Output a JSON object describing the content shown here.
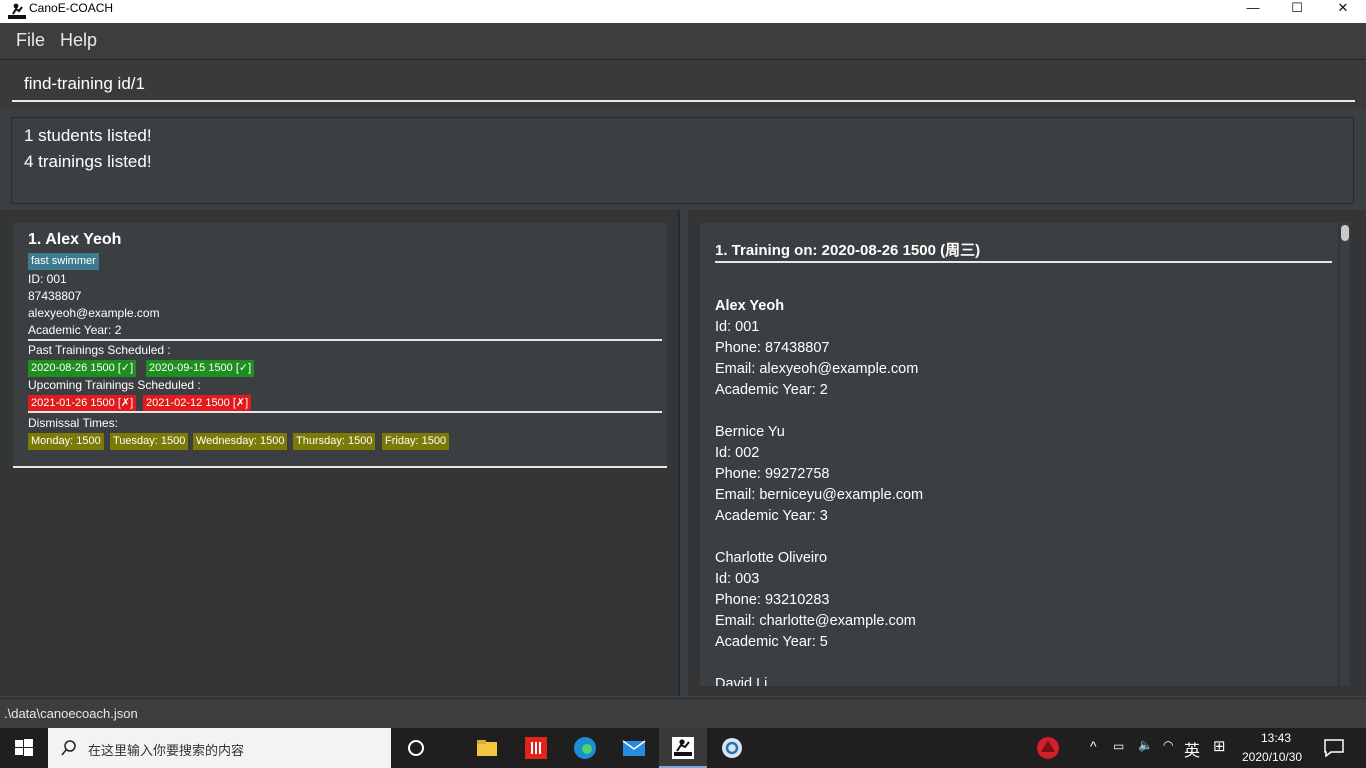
{
  "window": {
    "title": "CanoE-COACH",
    "minimize": "—",
    "maximize": "☐",
    "close": "✕"
  },
  "menu": {
    "file": "File",
    "help": "Help"
  },
  "command": {
    "value": "find-training id/1"
  },
  "result": {
    "line1": "1 students listed!",
    "line2": "4 trainings listed!"
  },
  "student_card": {
    "index_name": "1.  Alex Yeoh",
    "tag": "fast swimmer",
    "id": "ID: 001",
    "phone": "87438807",
    "email": "alexyeoh@example.com",
    "academic_year": "Academic Year: 2",
    "past_label": "Past Trainings Scheduled :",
    "past": [
      "2020-08-26 1500 [✓]",
      "2020-09-15 1500 [✓]"
    ],
    "upcoming_label": "Upcoming Trainings Scheduled :",
    "upcoming": [
      "2021-01-26 1500 [✗]",
      "2021-02-12 1500 [✗]"
    ],
    "dismissal_label": "Dismissal Times:",
    "dismissal": [
      "Monday: 1500",
      "Tuesday: 1500",
      "Wednesday: 1500",
      "Thursday: 1500",
      "Friday: 1500"
    ]
  },
  "training_panel": {
    "title": "1.  Training on: 2020-08-26 1500 (周三)",
    "students": [
      {
        "name": "Alex Yeoh",
        "id": "Id: 001",
        "phone": "Phone: 87438807",
        "email": "Email: alexyeoh@example.com",
        "year": "Academic  Year: 2"
      },
      {
        "name": "Bernice Yu",
        "id": "Id: 002",
        "phone": "Phone: 99272758",
        "email": "Email: berniceyu@example.com",
        "year": "Academic  Year: 3"
      },
      {
        "name": "Charlotte Oliveiro",
        "id": "Id: 003",
        "phone": "Phone: 93210283",
        "email": "Email: charlotte@example.com",
        "year": "Academic  Year: 5"
      },
      {
        "name": "David Li"
      }
    ]
  },
  "status": {
    "path": ".\\data\\canoecoach.json"
  },
  "taskbar": {
    "search_placeholder": "在这里输入你要搜索的内容",
    "ime": "英",
    "time": "13:43",
    "date": "2020/10/30"
  },
  "colors": {
    "tag_blue": "#3e7b91",
    "tag_green": "#1e8f1e",
    "tag_red": "#e11b1b",
    "tag_olive": "#7c7a06"
  }
}
